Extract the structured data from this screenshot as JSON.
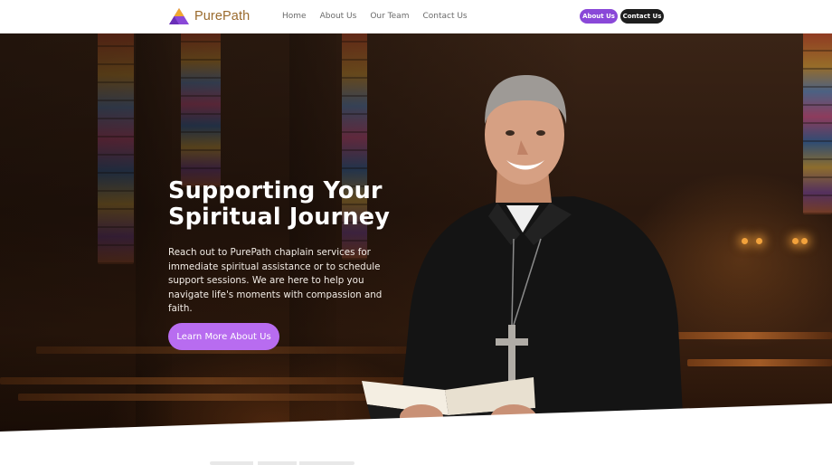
{
  "brand": {
    "name": "PurePath",
    "logo_icon": "pyramid-logo-icon"
  },
  "nav": {
    "items": [
      {
        "label": "Home"
      },
      {
        "label": "About Us"
      },
      {
        "label": "Our Team"
      },
      {
        "label": "Contact Us"
      }
    ],
    "about_button": "About Us",
    "contact_button": "Contact Us"
  },
  "hero": {
    "title_line1": "Supporting Your",
    "title_line2": "Spiritual Journey",
    "description": "Reach out to PurePath chaplain services for immediate spiritual assistance or to schedule support sessions. We are here to help you navigate life's moments with compassion and faith.",
    "cta_label": "Learn More About Us",
    "image_subject": "chaplain holding open book in church"
  },
  "colors": {
    "accent": "#8a48d8",
    "cta": "#b86cf0",
    "dark_button": "#1e1e1e",
    "brand_text": "#9a6a2c"
  }
}
